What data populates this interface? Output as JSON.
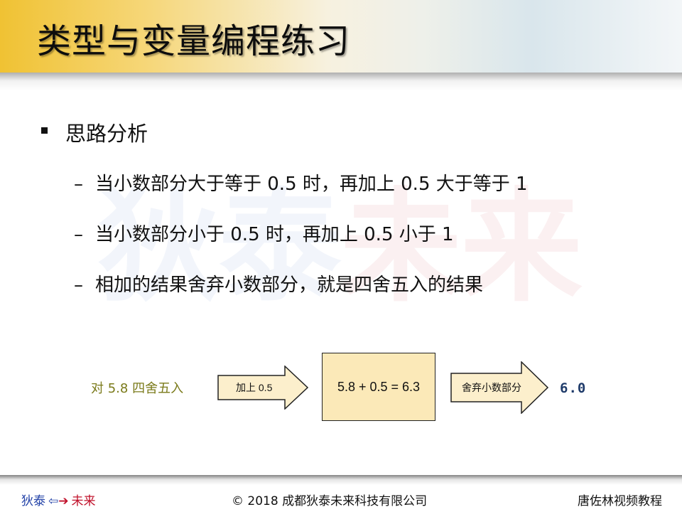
{
  "header": {
    "title": "类型与变量编程练习"
  },
  "watermark": {
    "part1": "狄泰",
    "part2": "未来"
  },
  "bullet": {
    "text": "思路分析"
  },
  "sub_items": [
    {
      "dash": "–",
      "text": "当小数部分大于等于 0.5 时，再加上 0.5 大于等于 1"
    },
    {
      "dash": "–",
      "text": "当小数部分小于 0.5 时，再加上 0.5 小于 1"
    },
    {
      "dash": "–",
      "text": "相加的结果舍弃小数部分，就是四舍五入的结果"
    }
  ],
  "flow": {
    "input_label": "对 5.8 四舍五入",
    "step1_label": "加上 0.5",
    "calc_text": "5.8 + 0.5 = 6.3",
    "step2_label": "舍弃小数部分",
    "result": "6.0"
  },
  "footer": {
    "brand_left": "狄泰",
    "arrow_left": "⇦",
    "arrow_right": "➔",
    "brand_right": "未来",
    "copyright": "© 2018 成都狄泰未来科技有限公司",
    "course": "唐佐林视频教程"
  },
  "colors": {
    "header_gold": "#f0c233",
    "header_blue": "#d9e6ec",
    "calc_box_fill": "#fbe9b8",
    "input_label": "#7a7a1a",
    "result": "#1f3b6a",
    "brand_blue": "#1f3fa6",
    "brand_red": "#c0102a"
  }
}
